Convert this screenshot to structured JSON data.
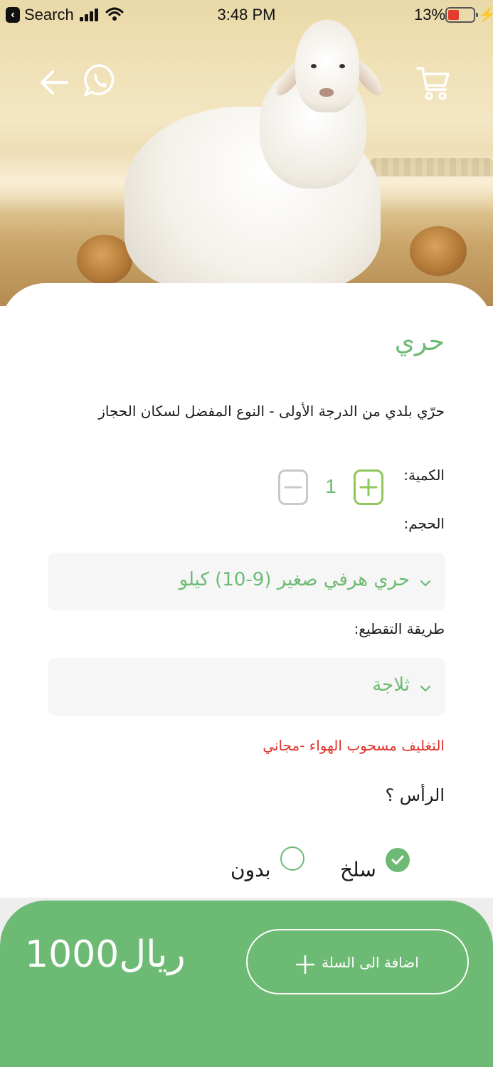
{
  "status_bar": {
    "back_app_label": "Search",
    "time": "3:48 PM",
    "battery_percent": "13%",
    "battery_level": 0.13
  },
  "product": {
    "title": "حري",
    "description": "حرّي بلدي من الدرجة الأولى - النوع المفضل لسكان الحجاز"
  },
  "quantity": {
    "label": "الكمية:",
    "value": "1"
  },
  "size": {
    "label": "الحجم:",
    "selected": "حري هرفي صغير (9-10) كيلو"
  },
  "cutting": {
    "label": "طريقة التقطيع:",
    "selected": "ثلاجة"
  },
  "packaging_note": "التغليف مسحوب الهواء -مجاني",
  "head_option": {
    "question": "الرأس ؟",
    "options": [
      {
        "label": "سلخ",
        "selected": true
      },
      {
        "label": "بدون",
        "selected": false
      }
    ]
  },
  "footer": {
    "price": "1000ريال",
    "add_to_cart_label": "اضافة الى السلة"
  },
  "colors": {
    "accent_green": "#6dba74",
    "plus_border": "#8fc75a",
    "note_red": "#e0332a"
  }
}
